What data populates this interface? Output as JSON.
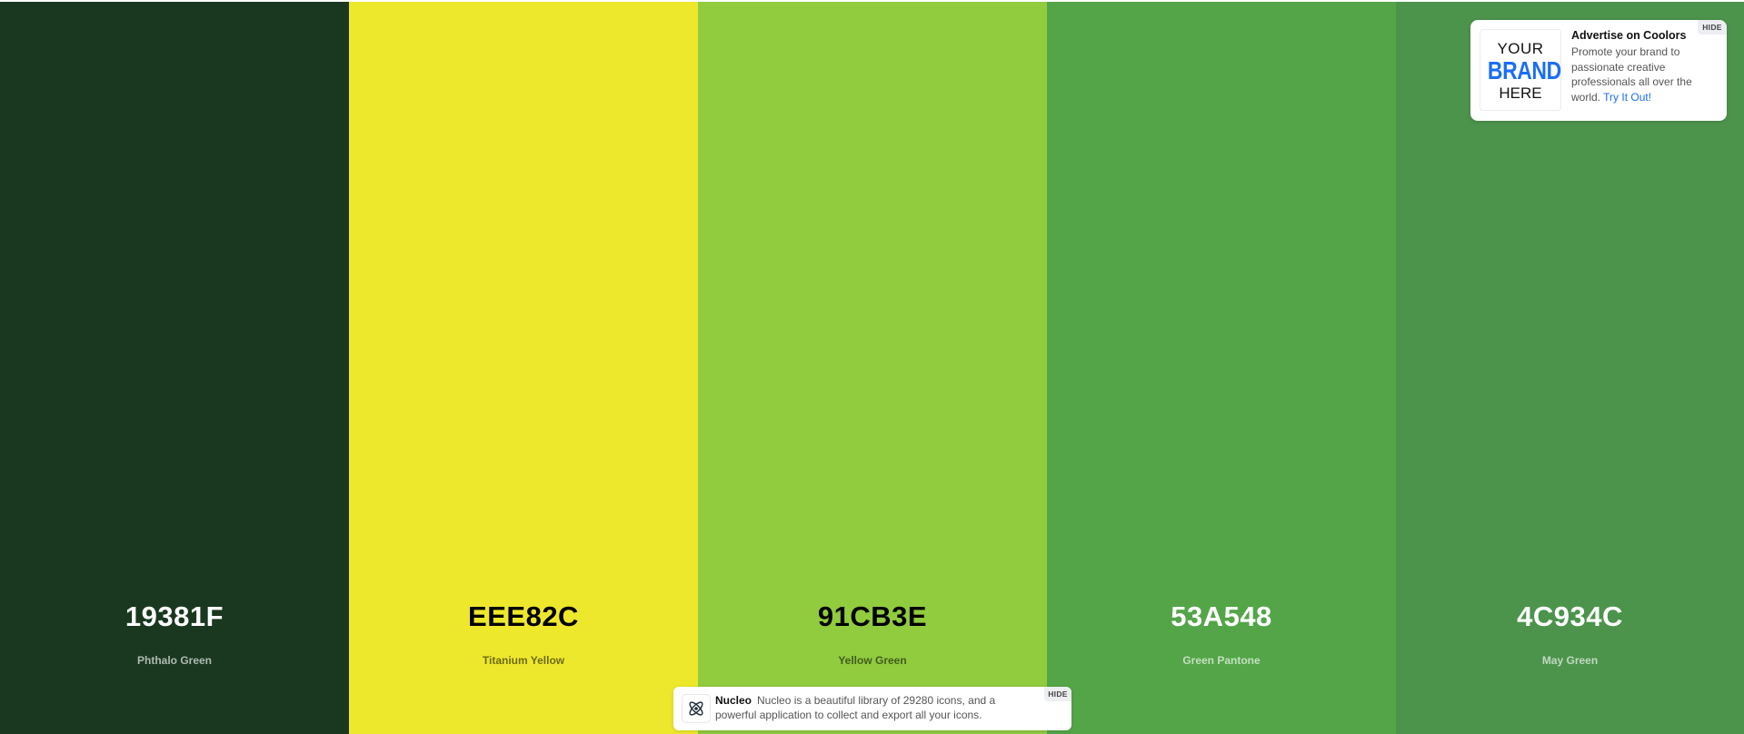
{
  "palette": {
    "colors": [
      {
        "hex": "19381F",
        "name": "Phthalo Green",
        "color": "#19381F",
        "text_theme": "light"
      },
      {
        "hex": "EEE82C",
        "name": "Titanium Yellow",
        "color": "#EEE82C",
        "text_theme": "dark"
      },
      {
        "hex": "91CB3E",
        "name": "Yellow Green",
        "color": "#91CB3E",
        "text_theme": "dark"
      },
      {
        "hex": "53A548",
        "name": "Green Pantone",
        "color": "#53A548",
        "text_theme": "light"
      },
      {
        "hex": "4C934C",
        "name": "May Green",
        "color": "#4C934C",
        "text_theme": "light"
      }
    ]
  },
  "ad": {
    "logo_line1": "YOUR",
    "logo_line2": "BRAND",
    "logo_line3": "HERE",
    "title": "Advertise on Coolors",
    "description": "Promote your brand to passionate creative professionals all over the world.",
    "link_label": "Try It Out!",
    "hide_label": "HIDE",
    "link_color": "#1a6ef5"
  },
  "nucleo": {
    "brand": "Nucleo",
    "description": "Nucleo is a beautiful library of 29280 icons, and a powerful application to collect and export all your icons.",
    "hide_label": "HIDE",
    "icon": "nucleo-atom-icon"
  }
}
